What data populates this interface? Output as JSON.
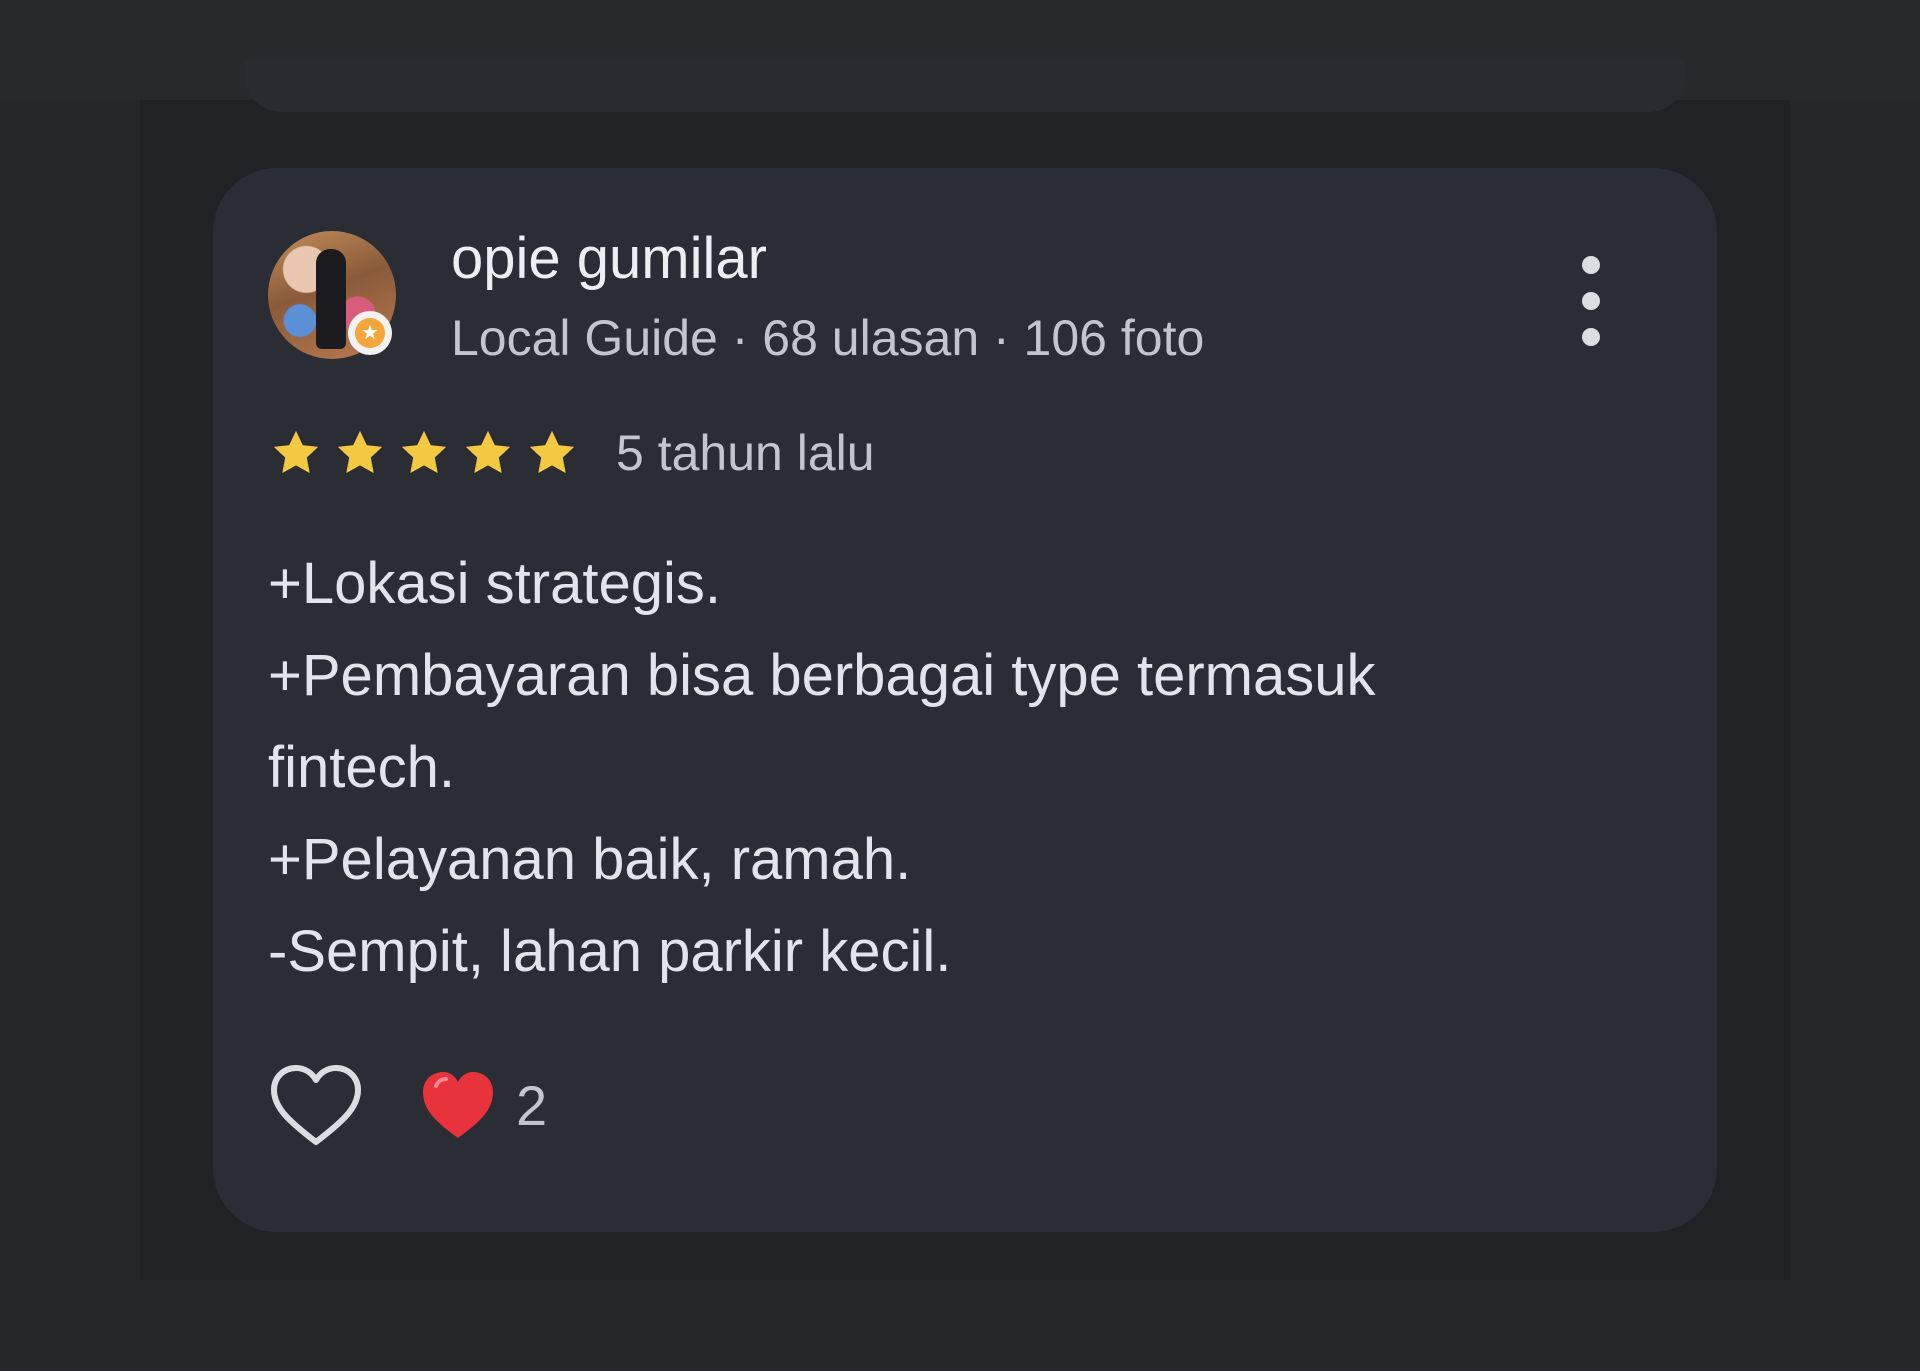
{
  "review": {
    "reviewer_name": "opie gumilar",
    "reviewer_meta": "Local Guide · 68 ulasan · 106 foto",
    "rating": 5,
    "rating_max": 5,
    "time_ago": "5 tahun lalu",
    "text_lines": [
      "+Lokasi strategis.",
      "+Pembayaran bisa berbagai type termasuk",
      "fintech.",
      "+Pelayanan baik, ramah.",
      "-Sempit, lahan parkir kecil."
    ],
    "reaction_count": "2"
  },
  "icons": {
    "avatar_badge": "local-guide-star-icon",
    "more": "more-vert-icon",
    "star": "star-icon",
    "like": "heart-outline-icon",
    "reaction": "red-heart-emoji-icon"
  },
  "colors": {
    "background": "#26272b",
    "card": "#2b2d35",
    "star": "#f5c842",
    "heart_reaction": "#e8323c",
    "text_primary": "#e2e4e9",
    "text_secondary": "#c3c5cb"
  }
}
